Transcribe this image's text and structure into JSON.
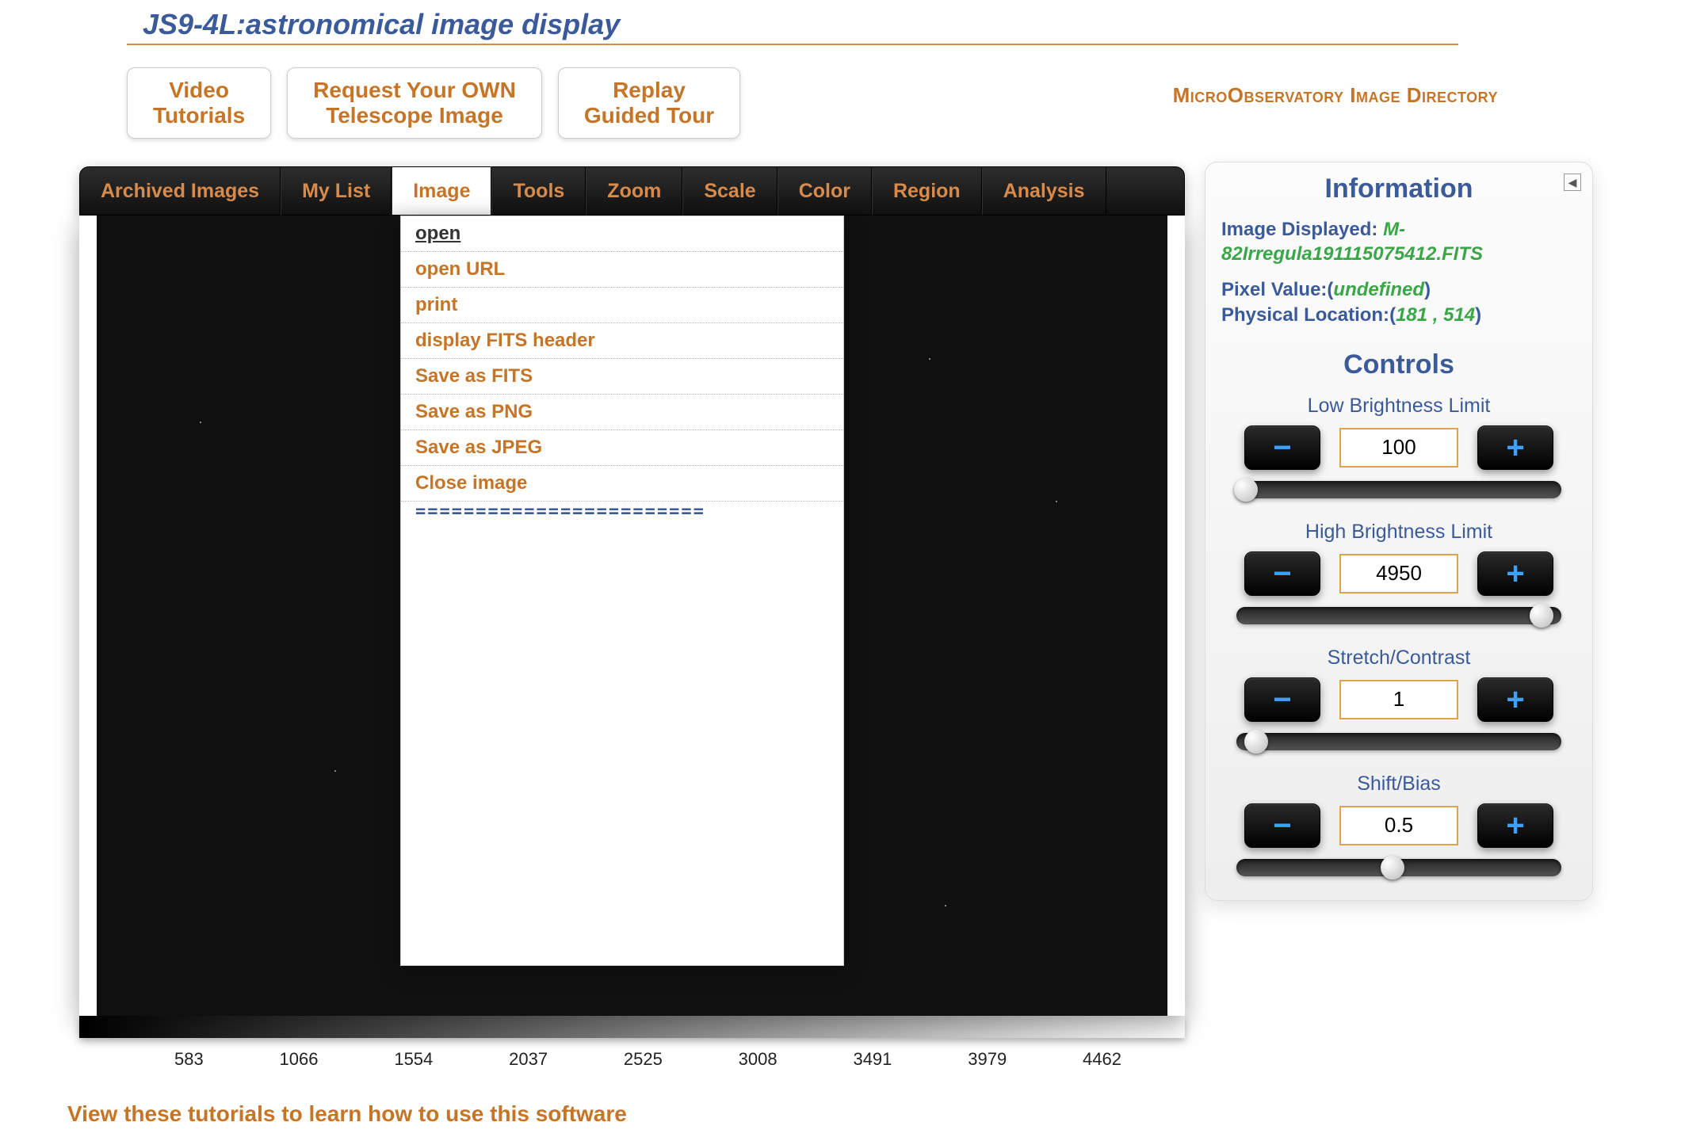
{
  "page_title": "JS9-4L:astronomical image display",
  "header_buttons": [
    "Video\nTutorials",
    "Request Your OWN\nTelescope Image",
    "Replay\nGuided Tour"
  ],
  "header_link": "MicroObservatory Image Directory",
  "menubar": [
    "Archived Images",
    "My List",
    "Image",
    "Tools",
    "Zoom",
    "Scale",
    "Color",
    "Region",
    "Analysis"
  ],
  "menubar_active_index": 2,
  "image_menu": {
    "items": [
      "open",
      "open URL",
      "print",
      "display FITS header",
      "Save as FITS",
      "Save as PNG",
      "Save as JPEG",
      "Close image"
    ],
    "separator": "========================"
  },
  "scale_ticks": [
    "583",
    "1066",
    "1554",
    "2037",
    "2525",
    "3008",
    "3491",
    "3979",
    "4462"
  ],
  "info": {
    "title": "Information",
    "image_label": "Image Displayed: ",
    "image_value": "M-82Irregula191115075412.FITS",
    "pixel_label": "Pixel Value:",
    "pixel_value": "undefined",
    "loc_label": "Physical Location:",
    "loc_value": "181 , 514"
  },
  "controls": {
    "title": "Controls",
    "groups": [
      {
        "label": "Low Brightness Limit",
        "value": "100",
        "thumb_pct": 3
      },
      {
        "label": "High Brightness Limit",
        "value": "4950",
        "thumb_pct": 94
      },
      {
        "label": "Stretch/Contrast",
        "value": "1",
        "thumb_pct": 6
      },
      {
        "label": "Shift/Bias",
        "value": "0.5",
        "thumb_pct": 48
      }
    ]
  },
  "bottom_text": "View these tutorials to learn how to use this software"
}
